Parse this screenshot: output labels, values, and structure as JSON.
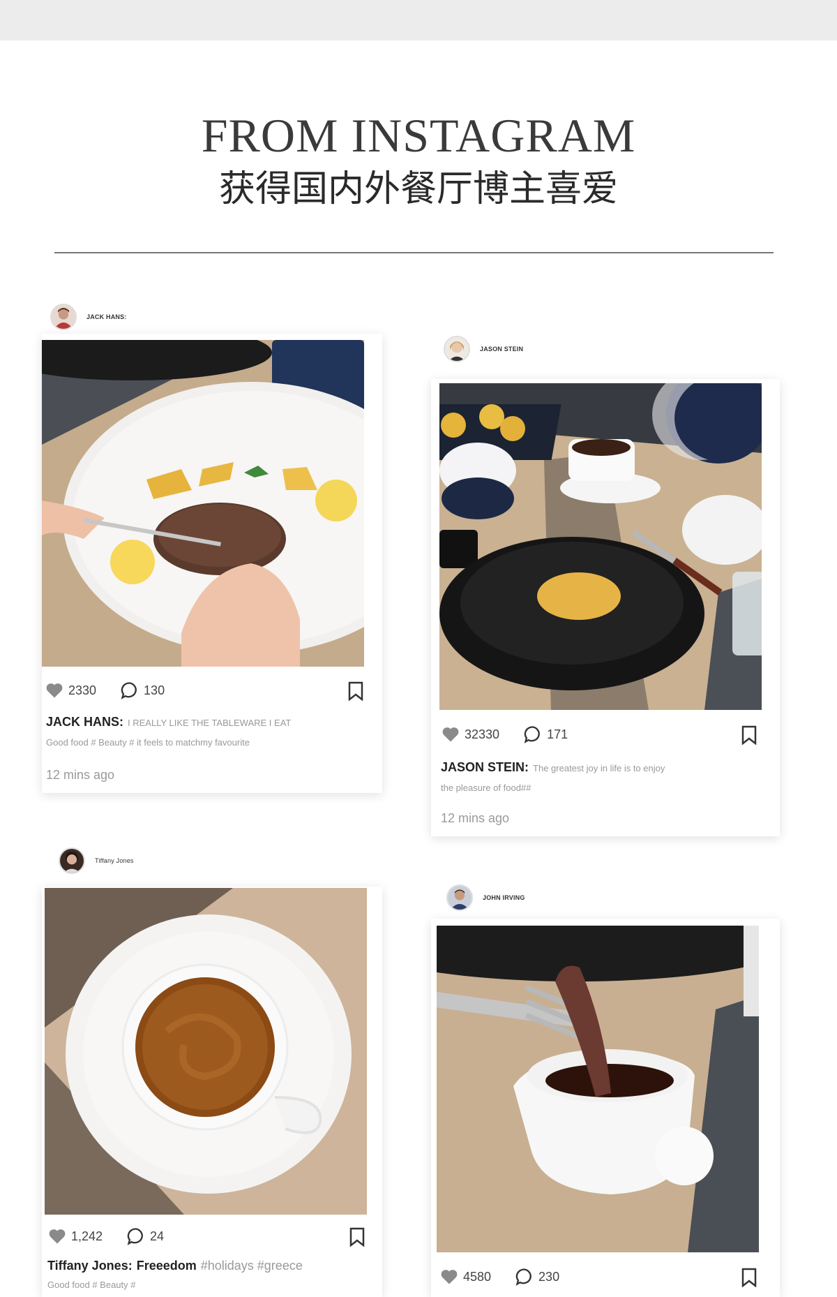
{
  "header": {
    "title_en": "FROM INSTAGRAM",
    "title_cn": "获得国内外餐厅博主喜爱"
  },
  "posts": [
    {
      "username": "JACK HANS:",
      "likes": "2330",
      "comments": "130",
      "caption_author": "JACK HANS:",
      "caption_text": "I REALLY LIKE THE TABLEWARE I EAT",
      "caption_line2": "Good food # Beauty #   it feels to matchmy favourite",
      "time": "12 mins ago"
    },
    {
      "username": "JASON STEIN",
      "likes": "32330",
      "comments": "171",
      "caption_author": "JASON STEIN:",
      "caption_text": "The greatest joy in life is to enjoy",
      "caption_line2": "the pleasure of food##",
      "time": "12 mins ago"
    },
    {
      "username": "Tiffany Jones",
      "likes": "1,242",
      "comments": "24",
      "caption_author": "Tiffany Jones:",
      "caption_text": "Freeedom",
      "caption_tags": "#holidays #greece",
      "caption_line2": "Good food # Beauty #"
    },
    {
      "username": "JOHN IRVING",
      "likes": "4580",
      "comments": "230"
    }
  ],
  "icons": {
    "like": "heart-icon",
    "comment": "comment-icon",
    "save": "bookmark-icon"
  },
  "colors": {
    "heart": "#8a8a8a",
    "divider": "#777777",
    "topbar": "#ececec"
  }
}
